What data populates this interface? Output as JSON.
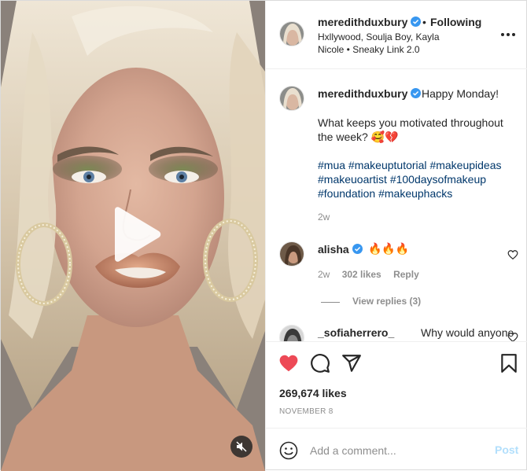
{
  "post": {
    "author": "meredithduxbury",
    "follow_status": "Following",
    "separator": "•",
    "audio_info": "Hxllywood, Soulja Boy, Kayla Nicole • Sneaky Link 2.0",
    "caption": {
      "username": "meredithduxbury",
      "first_line": "Happy Monday!",
      "body": "What keeps you motivated throughout the week? 🥰💔",
      "hashtags": [
        "#mua",
        "#makeuptutorial",
        "#makeupideas",
        "#makeuoartist",
        "#100daysofmakeup",
        "#foundation",
        "#makeuphacks"
      ],
      "time": "2w"
    },
    "comments": [
      {
        "username": "alisha",
        "text": "🔥🔥🔥",
        "time": "2w",
        "likes": "302 likes",
        "reply_label": "Reply",
        "view_replies": "View replies (3)"
      },
      {
        "username": "_sofiaherrero_",
        "text": "Why would anyone"
      }
    ],
    "likes_count": "269,674 likes",
    "date": "NOVEMBER 8",
    "add_comment_placeholder": "Add a comment...",
    "post_button": "Post"
  },
  "icons": {
    "verified": "verified-badge-icon",
    "liked": "heart-filled-icon",
    "comment": "comment-bubble-icon",
    "share": "paper-plane-icon",
    "save": "bookmark-icon",
    "more": "more-options-icon",
    "play": "play-icon",
    "mute": "muted-speaker-icon",
    "emoji": "emoji-smiley-icon"
  },
  "colors": {
    "verified_blue": "#3897f0",
    "like_red": "#ed4956",
    "hashtag_blue": "#00376b",
    "post_button_disabled": "#b2dffc",
    "muted_text": "#8e8e8e"
  }
}
